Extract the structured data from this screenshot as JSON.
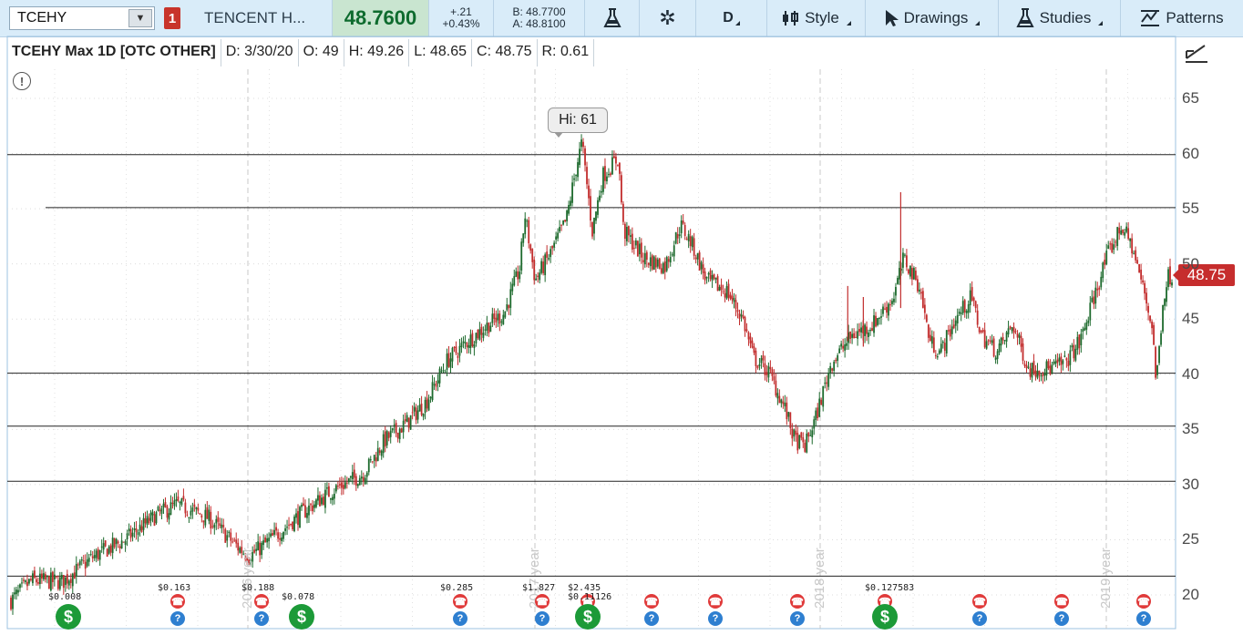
{
  "toolbar": {
    "symbol": "TCEHY",
    "alert_count": "1",
    "company": "TENCENT H...",
    "last_price": "48.7600",
    "change_abs": "+.21",
    "change_pct": "+0.43%",
    "bid": "B: 48.7700",
    "ask": "A: 48.8100",
    "aggregation": "D",
    "style_label": "Style",
    "drawings_label": "Drawings",
    "studies_label": "Studies",
    "patterns_label": "Patterns"
  },
  "chart_header": {
    "title": "TCEHY Max 1D [OTC OTHER]",
    "date": "D: 3/30/20",
    "open": "O: 49",
    "high": "H: 49.26",
    "low": "L: 48.65",
    "close": "C: 48.75",
    "range": "R: 0.61"
  },
  "hi_bubble": "Hi: 61",
  "current_price_tag": "48.75",
  "colors": {
    "up": "#1d6a2d",
    "down": "#c22d2d",
    "accent_green": "#0e6b2e",
    "alert_red": "#c8342b"
  },
  "chart_data": {
    "type": "candlestick",
    "ylim": [
      18.5,
      67
    ],
    "y_ticks": [
      20,
      25,
      30,
      35,
      40,
      45,
      50,
      55,
      60,
      65
    ],
    "year_labels": [
      "2016 year",
      "2017 year",
      "2018 year",
      "2019 year"
    ],
    "horizontal_levels": [
      21.7,
      30.3,
      35.3,
      40.1,
      55.1,
      59.9
    ],
    "price_path": [
      [
        0,
        19.5
      ],
      [
        0.02,
        21.3
      ],
      [
        0.05,
        21.2
      ],
      [
        0.08,
        23.5
      ],
      [
        0.11,
        25.0
      ],
      [
        0.14,
        27.2
      ],
      [
        0.16,
        28.2
      ],
      [
        0.19,
        27.0
      ],
      [
        0.22,
        24.2
      ],
      [
        0.23,
        23.5
      ],
      [
        0.25,
        25.0
      ],
      [
        0.28,
        27.4
      ],
      [
        0.31,
        29.5
      ],
      [
        0.34,
        31.0
      ],
      [
        0.36,
        34.0
      ],
      [
        0.38,
        35.5
      ],
      [
        0.4,
        37.5
      ],
      [
        0.42,
        41.2
      ],
      [
        0.44,
        43.0
      ],
      [
        0.46,
        44.5
      ],
      [
        0.475,
        45.5
      ],
      [
        0.49,
        49.5
      ],
      [
        0.495,
        54.5
      ],
      [
        0.505,
        48.5
      ],
      [
        0.52,
        51.0
      ],
      [
        0.535,
        54.0
      ],
      [
        0.545,
        59.0
      ],
      [
        0.55,
        61.0
      ],
      [
        0.56,
        53.0
      ],
      [
        0.57,
        58.0
      ],
      [
        0.585,
        59.6
      ],
      [
        0.59,
        53.0
      ],
      [
        0.61,
        50.5
      ],
      [
        0.63,
        49.8
      ],
      [
        0.645,
        53.5
      ],
      [
        0.655,
        52.0
      ],
      [
        0.67,
        48.5
      ],
      [
        0.69,
        47.5
      ],
      [
        0.705,
        45.0
      ],
      [
        0.715,
        41.5
      ],
      [
        0.73,
        40.2
      ],
      [
        0.745,
        37.0
      ],
      [
        0.755,
        34.0
      ],
      [
        0.765,
        33.5
      ],
      [
        0.775,
        36.0
      ],
      [
        0.79,
        41.0
      ],
      [
        0.81,
        43.5
      ],
      [
        0.83,
        44.5
      ],
      [
        0.85,
        47.0
      ],
      [
        0.86,
        50.5
      ],
      [
        0.875,
        48.0
      ],
      [
        0.885,
        43.0
      ],
      [
        0.895,
        42.0
      ],
      [
        0.91,
        45.0
      ],
      [
        0.925,
        47.0
      ],
      [
        0.935,
        43.5
      ],
      [
        0.95,
        42.0
      ],
      [
        0.965,
        44.5
      ],
      [
        0.98,
        40.5
      ],
      [
        1.0,
        40.5
      ],
      [
        1.015,
        41.0
      ],
      [
        1.03,
        43.0
      ],
      [
        1.045,
        47.5
      ],
      [
        1.055,
        50.5
      ],
      [
        1.07,
        53.5
      ],
      [
        1.08,
        51.5
      ],
      [
        1.09,
        48.0
      ],
      [
        1.1,
        44.0
      ],
      [
        1.103,
        39.0
      ],
      [
        1.11,
        47.0
      ],
      [
        1.115,
        49.0
      ],
      [
        1.12,
        48.75
      ]
    ],
    "spikes": [
      [
        0.857,
        56.5,
        46.0
      ],
      [
        0.806,
        43.0,
        48.0
      ],
      [
        0.821,
        42.5,
        47.0
      ]
    ],
    "events": [
      {
        "type": "dividend",
        "pos": 0.0,
        "label": "$0.008"
      },
      {
        "type": "earnings",
        "pos": 0.06,
        "label": "$0.163"
      },
      {
        "type": "earnings",
        "pos": 0.106,
        "label": "$0.188"
      },
      {
        "type": "dividend",
        "pos": 0.128,
        "label": "$0.078"
      },
      {
        "type": "earnings",
        "pos": 0.215,
        "label": "$0.285"
      },
      {
        "type": "earnings",
        "pos": 0.26,
        "label": "$1.827"
      },
      {
        "type": "earnings",
        "pos": 0.285,
        "label": "$2.435"
      },
      {
        "type": "dividend",
        "pos": 0.285,
        "label": "$0.11126"
      },
      {
        "type": "earnings",
        "pos": 0.32,
        "label": ""
      },
      {
        "type": "earnings",
        "pos": 0.355,
        "label": ""
      },
      {
        "type": "earnings",
        "pos": 0.4,
        "label": ""
      },
      {
        "type": "earnings",
        "pos": 0.448,
        "label": "$0.127583"
      },
      {
        "type": "dividend",
        "pos": 0.448,
        "label": ""
      },
      {
        "type": "earnings",
        "pos": 0.5,
        "label": ""
      },
      {
        "type": "earnings",
        "pos": 0.545,
        "label": ""
      },
      {
        "type": "earnings",
        "pos": 0.59,
        "label": ""
      }
    ]
  }
}
